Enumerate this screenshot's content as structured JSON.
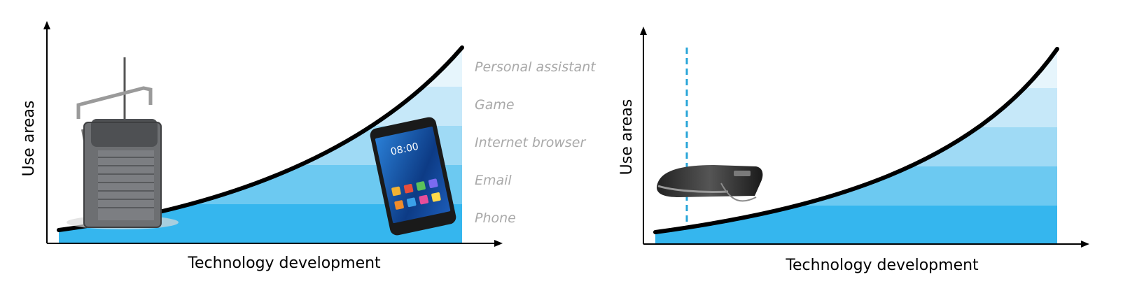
{
  "left_diagram": {
    "x_axis_label": "Technology development",
    "y_axis_label": "Use areas",
    "bands": [
      {
        "label": "Phone",
        "color": "#35b6ee"
      },
      {
        "label": "Email",
        "color": "#6cc9f1"
      },
      {
        "label": "Internet browser",
        "color": "#9fdaf5"
      },
      {
        "label": "Game",
        "color": "#c6e8f9"
      },
      {
        "label": "Personal assistant",
        "color": "#e6f5fc"
      }
    ],
    "images": [
      "vintage-radio-phone",
      "smartphone"
    ]
  },
  "right_diagram": {
    "x_axis_label": "Technology development",
    "y_axis_label": "Use areas",
    "bands": [
      {
        "color": "#35b6ee"
      },
      {
        "color": "#6cc9f1"
      },
      {
        "color": "#9fdaf5"
      },
      {
        "color": "#c6e8f9"
      },
      {
        "color": "#e6f5fc"
      }
    ],
    "marker_color": "#2aa6d8",
    "images": [
      "mixed-reality-headset"
    ]
  }
}
